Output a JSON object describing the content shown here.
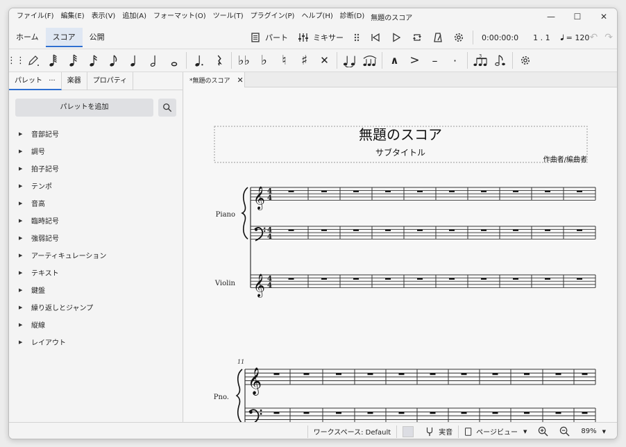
{
  "menu": {
    "items": [
      "ファイル(F)",
      "編集(E)",
      "表示(V)",
      "追加(A)",
      "フォーマット(O)",
      "ツール(T)",
      "プラグイン(P)",
      "ヘルプ(H)",
      "診断(D)"
    ],
    "title": "無題のスコア"
  },
  "tabs": {
    "home": "ホーム",
    "score": "スコア",
    "publish": "公開"
  },
  "playback": {
    "parts_label": "パート",
    "mixer_label": "ミキサー",
    "time": "0:00:00:0",
    "position": "1 . 1",
    "tempo": "= 120"
  },
  "left_panel": {
    "tabs": {
      "palette": "パレット",
      "palette_more": "···",
      "instruments": "楽器",
      "properties": "プロパティ"
    },
    "add_palette": "パレットを追加",
    "items": [
      "音部記号",
      "調号",
      "拍子記号",
      "テンポ",
      "音高",
      "臨時記号",
      "強弱記号",
      "アーティキュレーション",
      "テキスト",
      "鍵盤",
      "繰り返しとジャンプ",
      "縦線",
      "レイアウト"
    ]
  },
  "document": {
    "tab_label": "*無題のスコア"
  },
  "score": {
    "title": "無題のスコア",
    "subtitle": "サブタイトル",
    "composer": "作曲者/編曲者",
    "instruments": [
      "Piano",
      "Violin"
    ],
    "short_name": "Pno.",
    "measure_number": "11",
    "time_signature": "4/4"
  },
  "status": {
    "workspace": "ワークスペース: Default",
    "concert_pitch": "実音",
    "view_mode": "ページビュー",
    "zoom": "89%"
  },
  "colors": {
    "accent": "#2f6fd0",
    "tab_bg": "#dfe7f3"
  }
}
